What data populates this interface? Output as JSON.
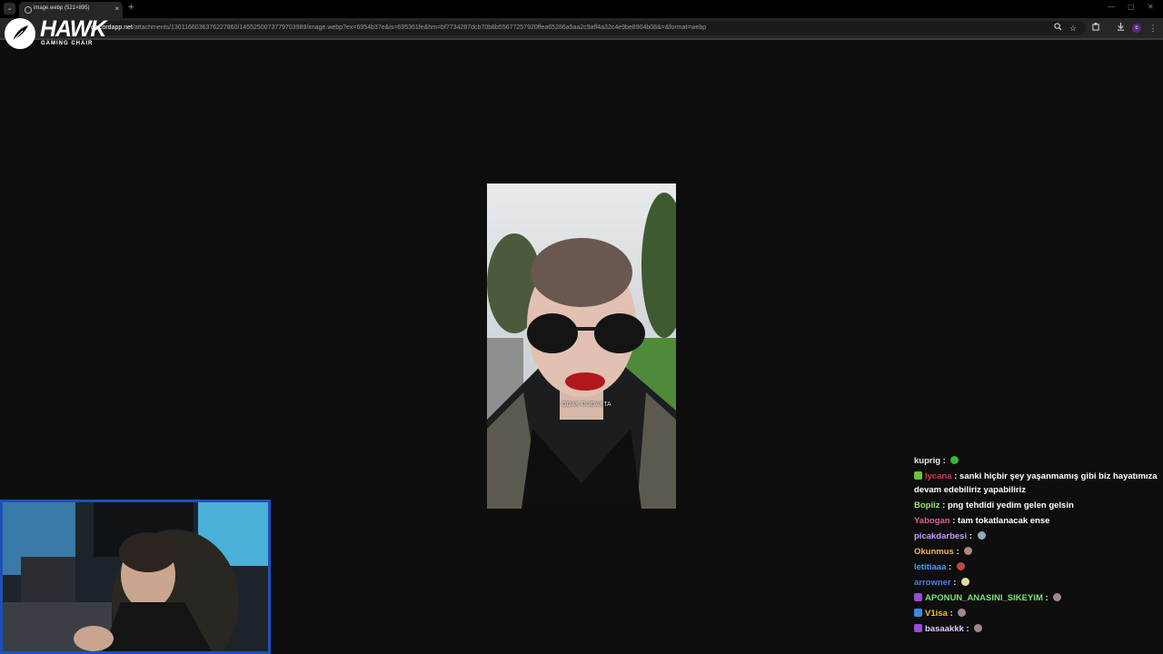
{
  "browser": {
    "tab_title": "image.webp (521×895)",
    "tab_close": "×",
    "new_tab": "+",
    "tab_menu": "⌄",
    "url_host": "discordapp.net",
    "url_path": "/attachments/1301166036376227860/1455250073779703989/image.webp?ex=6954b37e&is=695361fe&hm=bf7734287dcb70b8b55677257920ffea65286a5aa2c9aff4a32c4e9be8904b08&=&format=webp",
    "profile_initial": "c",
    "window_minimize": "—",
    "window_restore": "▢",
    "window_close": "✕"
  },
  "overlay": {
    "logo_word": "HAWK",
    "logo_sub": "GAMING CHAIR"
  },
  "image": {
    "caption": "ODAK DUDAKTA"
  },
  "chat": {
    "messages": [
      {
        "user": "kuprig",
        "sep": " : ",
        "text": "",
        "color": "#e6e6e6",
        "badge": "",
        "emote": "#3ab83a"
      },
      {
        "user": "lycana",
        "sep": " : ",
        "text": "sanki hiçbir şey yaşanmamış gibi biz hayatımıza",
        "color": "#d23a5a",
        "badge": "#6ec13a",
        "emote": ""
      },
      {
        "user": "",
        "sep": "",
        "text": "devam edebiliriz yapabiliriz",
        "color": "#ffffff",
        "badge": "",
        "emote": ""
      },
      {
        "user": "Bopiiz",
        "sep": " : ",
        "text": "png tehdidi yedim gelen gelsin",
        "color": "#9be57a",
        "badge": "",
        "emote": ""
      },
      {
        "user": "Yabogan",
        "sep": " : ",
        "text": "tam tokatlanacak ense",
        "color": "#e05a9a",
        "badge": "",
        "emote": ""
      },
      {
        "user": "picakdarbesi",
        "sep": " : ",
        "text": "",
        "color": "#c49cff",
        "badge": "",
        "emote": "#8ab0b8"
      },
      {
        "user": "Okunmus",
        "sep": " : ",
        "text": "",
        "color": "#f0b060",
        "badge": "",
        "emote": "#b08878"
      },
      {
        "user": "letitiaaa",
        "sep": " : ",
        "text": "",
        "color": "#4a9cf0",
        "badge": "",
        "emote": "#c04a3a"
      },
      {
        "user": "arrowner",
        "sep": " : ",
        "text": "",
        "color": "#4a7cf0",
        "badge": "",
        "emote": "#e8d8a0"
      },
      {
        "user": "APONUN_ANASINI_SIKEYIM",
        "sep": " : ",
        "text": "",
        "color": "#7ae07a",
        "badge": "#9a4ad8",
        "emote": "#a08890"
      },
      {
        "user": "V1isa",
        "sep": " : ",
        "text": "",
        "color": "#f0c020",
        "badge": "#3a8ae8",
        "emote": "#a08890"
      },
      {
        "user": "basaakkk",
        "sep": " : ",
        "text": "",
        "color": "#e0c8ff",
        "badge": "#9a4ad8",
        "emote": "#a08890"
      }
    ]
  }
}
